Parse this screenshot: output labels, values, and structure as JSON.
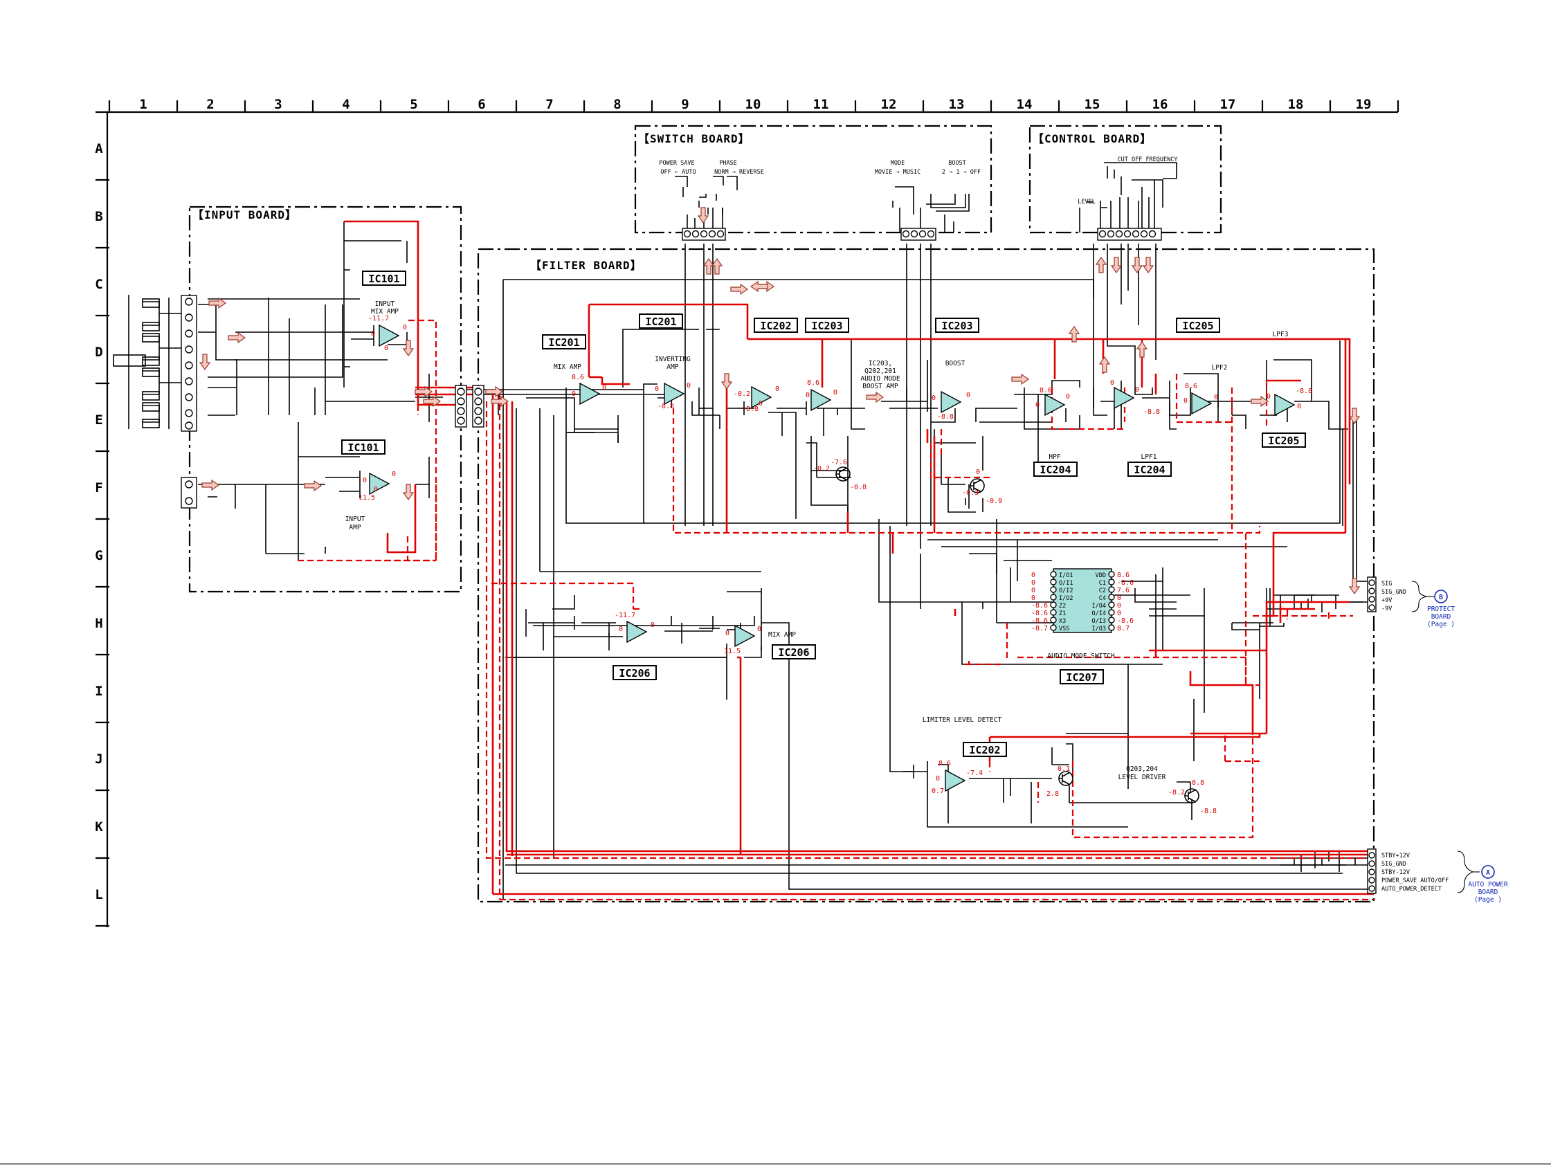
{
  "ruler": {
    "columns": [
      "1",
      "2",
      "3",
      "4",
      "5",
      "6",
      "7",
      "8",
      "9",
      "10",
      "11",
      "12",
      "13",
      "14",
      "15",
      "16",
      "17",
      "18",
      "19"
    ],
    "rows": [
      "A",
      "B",
      "C",
      "D",
      "E",
      "F",
      "G",
      "H",
      "I",
      "J",
      "K",
      "L"
    ]
  },
  "boards": {
    "input": "【INPUT BOARD】",
    "switch": "【SWITCH BOARD】",
    "control": "【CONTROL BOARD】",
    "filter": "【FILTER BOARD】"
  },
  "ic_labels": {
    "ic101_top": "IC101",
    "ic101_bot": "IC101",
    "ic201_a": "IC201",
    "ic201_b": "IC201",
    "ic202_top": "IC202",
    "ic203_a": "IC203",
    "ic203_b": "IC203",
    "ic205_top": "IC205",
    "ic205_bot": "IC205",
    "ic204_hpf": "IC204",
    "ic204_lpf1": "IC204",
    "ic206_a": "IC206",
    "ic206_b": "IC206",
    "ic207": "IC207",
    "ic202_bot": "IC202"
  },
  "stage_labels": {
    "input_mix_amp": [
      "INPUT",
      "MIX AMP"
    ],
    "input_amp": [
      "INPUT",
      "AMP"
    ],
    "mix_amp_201": "MIX AMP",
    "inverting_amp": [
      "INVERTING",
      "AMP"
    ],
    "audio_mode_boost": [
      "IC203,",
      "Q202,201",
      "AUDIO MODE",
      "BOOST AMP"
    ],
    "boost": "BOOST",
    "hpf": "HPF",
    "lpf1": "LPF1",
    "lpf2": "LPF2",
    "lpf3": "LPF3",
    "mix_amp_206": "MIX AMP",
    "audio_mode_switch": "AUDIO MODE SWITCH",
    "limiter_level_detect": "LIMITER LEVEL DETECT",
    "level_driver": [
      "Q203,204",
      "LEVEL DRIVER"
    ]
  },
  "switches": {
    "power_save": "POWER SAVE",
    "power_save_opts": "OFF ← AUTO",
    "phase": "PHASE",
    "phase_opts": "NORM → REVERSE",
    "mode": "MODE",
    "mode_opts": "MOVIE → MUSIC",
    "boost": "BOOST",
    "boost_opts": "2 → 1 → OFF",
    "cutoff": "CUT OFF FREQUENCY",
    "level": "LEVEL"
  },
  "voltages": {
    "ic101a": [
      "-11.7",
      "0",
      "0",
      "0"
    ],
    "ic101b": [
      "0",
      "0",
      "11.5",
      "0"
    ],
    "ic201a": [
      "8.6",
      "0",
      "0"
    ],
    "ic201b": [
      "0",
      "0",
      "-8.8"
    ],
    "ic202a": [
      "-0.2",
      "0",
      "-8.8",
      "0"
    ],
    "ic203a": [
      "8.6",
      "0",
      "0"
    ],
    "q202": [
      "-7.6",
      "-0.2",
      "-0.8"
    ],
    "ic203b": [
      "0",
      "0",
      "-8.8"
    ],
    "q201": [
      "-0.3",
      "0",
      "-0.9"
    ],
    "ic204a": [
      "8.6",
      "0",
      "0"
    ],
    "ic204b": [
      "0",
      "0",
      "-8.8"
    ],
    "ic205a": [
      "8.6",
      "0",
      "0"
    ],
    "ic205b": [
      "0",
      "-8.8",
      "0"
    ],
    "ic206a": [
      "-11.7",
      "0",
      "0"
    ],
    "ic206b": [
      "0",
      "0",
      "11.5"
    ],
    "ic207_left": [
      "0",
      "0",
      "0",
      "0",
      "-8.6",
      "-8.6",
      "-8.6",
      "-8.7"
    ],
    "ic207_right": [
      "8.6",
      "-8.6",
      "7.6",
      "0",
      "0",
      "0",
      "-8.6",
      "8.7"
    ],
    "ic202b": [
      "8.6",
      "0",
      "0.7",
      "-7.4"
    ],
    "q203": [
      "0.1",
      "2.8"
    ],
    "q204": [
      "-8.8",
      "-8.2",
      "-8.8"
    ]
  },
  "ic207_pins": {
    "left": [
      "I/O1",
      "O/I1",
      "O/I2",
      "I/O2",
      "Z2",
      "Z1",
      "X3",
      "VSS"
    ],
    "right": [
      "VDD",
      "C1",
      "C2",
      "C4",
      "I/O4",
      "O/I4",
      "O/I3",
      "I/O3"
    ]
  },
  "protect_connector": {
    "pins": [
      "SIG",
      "SIG_GND",
      "+9V",
      "-9V"
    ],
    "target_letter": "B",
    "target": [
      "PROTECT",
      "BOARD",
      "(Page )"
    ]
  },
  "power_connector": {
    "pins": [
      "STBY+12V",
      "SIG_GND",
      "STBY-12V",
      "POWER_SAVE  AUTO/OFF",
      "AUTO_POWER_DETECT"
    ],
    "target_letter": "A",
    "target": [
      "AUTO POWER",
      "BOARD",
      "(Page )"
    ]
  },
  "colors": {
    "signal": "#e00000",
    "opamp_fill": "#a8e0dc",
    "arrow_fill": "#f6c8c0",
    "link": "#1428b4"
  }
}
